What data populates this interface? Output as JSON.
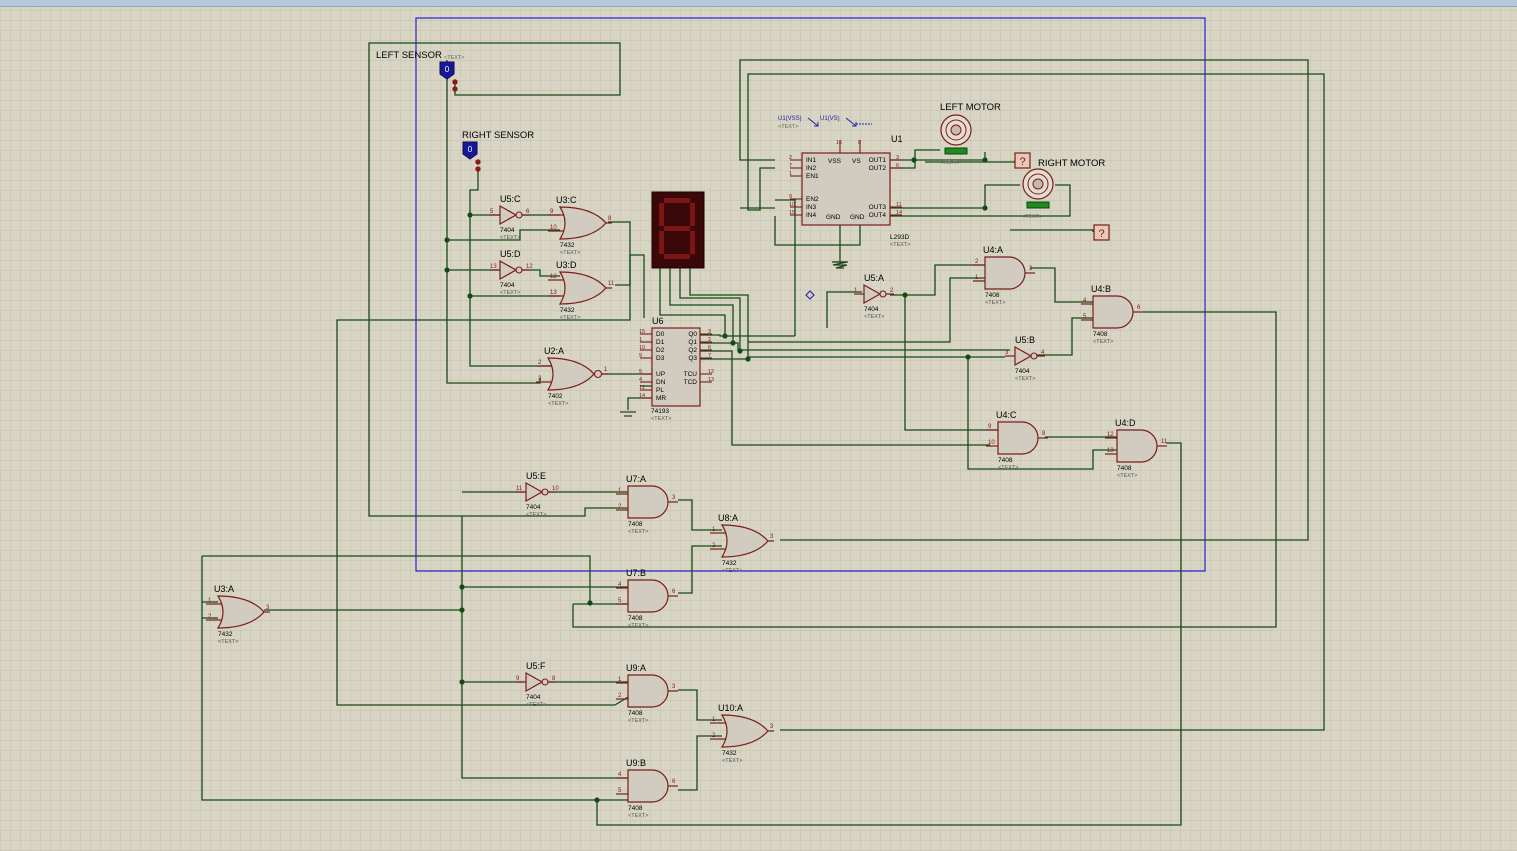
{
  "colors": {
    "background": "#d8d5c4",
    "grid": "#c4c1ae",
    "wire": "#154a15",
    "component_body": "#d2ccc0",
    "component_outline": "#7a1c1c",
    "label": "#000000",
    "sub_label": "#555555",
    "sheet_border": "#2525d0",
    "seven_segment_bg": "#3a0808",
    "seven_segment_on": "#7c1515",
    "probe": "#18189a",
    "motor_indicator": "#1f8a1f"
  },
  "sensors": [
    {
      "id": "left",
      "label": "LEFT SENSOR",
      "value": "0",
      "text": "<TEXT>"
    },
    {
      "id": "right",
      "label": "RIGHT SENSOR",
      "value": "0"
    }
  ],
  "motors": [
    {
      "id": "left",
      "label": "LEFT MOTOR",
      "text": "<TEXT>",
      "unknown": "?"
    },
    {
      "id": "right",
      "label": "RIGHT MOTOR",
      "text": "<TEXT>",
      "unknown": "?"
    }
  ],
  "driver": {
    "name": "U1",
    "part": "L293D",
    "text": "<TEXT>",
    "power_labels": [
      "U1(VSS)",
      "U1(VS)"
    ],
    "pins_left": [
      {
        "name": "IN1",
        "num": "2"
      },
      {
        "name": "IN2",
        "num": "7"
      },
      {
        "name": "EN1",
        "num": "1"
      },
      {
        "name": "EN2",
        "num": "9"
      },
      {
        "name": "IN3",
        "num": "10"
      },
      {
        "name": "IN4",
        "num": "15"
      }
    ],
    "pins_right": [
      {
        "name": "OUT1",
        "num": "3"
      },
      {
        "name": "OUT2",
        "num": "6"
      },
      {
        "name": "OUT3",
        "num": "11"
      },
      {
        "name": "OUT4",
        "num": "14"
      }
    ],
    "top": [
      "VSS",
      "VS"
    ],
    "top_nums": [
      "16",
      "8"
    ],
    "bottom": [
      "GND",
      "GND"
    ]
  },
  "counter": {
    "name": "U6",
    "part": "74193",
    "text": "<TEXT>",
    "pins_left": [
      {
        "name": "D0",
        "num": "15"
      },
      {
        "name": "D1",
        "num": "1"
      },
      {
        "name": "D2",
        "num": "10"
      },
      {
        "name": "D3",
        "num": "9"
      },
      {
        "name": "UP",
        "num": "5"
      },
      {
        "name": "DN",
        "num": "4"
      },
      {
        "name": "PL",
        "num": "11"
      },
      {
        "name": "MR",
        "num": "14"
      }
    ],
    "pins_right": [
      {
        "name": "Q0",
        "num": "3"
      },
      {
        "name": "Q1",
        "num": "2"
      },
      {
        "name": "Q2",
        "num": "6"
      },
      {
        "name": "Q3",
        "num": "7"
      },
      {
        "name": "TCU",
        "num": "12"
      },
      {
        "name": "TCD",
        "num": "13"
      }
    ]
  },
  "gates": [
    {
      "name": "U5:C",
      "part": "7404",
      "type": "not",
      "pins": [
        "5",
        "6"
      ],
      "text": "<TEXT>"
    },
    {
      "name": "U5:D",
      "part": "7404",
      "type": "not",
      "pins": [
        "13",
        "12"
      ],
      "text": "<TEXT>"
    },
    {
      "name": "U3:C",
      "part": "7432",
      "type": "or",
      "pins": [
        "9",
        "10",
        "8"
      ],
      "text": "<TEXT>"
    },
    {
      "name": "U3:D",
      "part": "7432",
      "type": "or",
      "pins": [
        "12",
        "13",
        "11"
      ],
      "text": "<TEXT>"
    },
    {
      "name": "U2:A",
      "part": "7402",
      "type": "nor",
      "pins": [
        "2",
        "3",
        "1"
      ],
      "text": "<TEXT>"
    },
    {
      "name": "U5:A",
      "part": "7404",
      "type": "not",
      "pins": [
        "1",
        "2"
      ],
      "text": "<TEXT>"
    },
    {
      "name": "U4:A",
      "part": "7408",
      "type": "and",
      "pins": [
        "2",
        "1",
        "3"
      ],
      "text": "<TEXT>"
    },
    {
      "name": "U4:B",
      "part": "7408",
      "type": "and",
      "pins": [
        "4",
        "5",
        "6"
      ],
      "text": "<TEXT>"
    },
    {
      "name": "U5:B",
      "part": "7404",
      "type": "not",
      "pins": [
        "3",
        "4"
      ],
      "text": "<TEXT>"
    },
    {
      "name": "U4:C",
      "part": "7408",
      "type": "and",
      "pins": [
        "9",
        "10",
        "8"
      ],
      "text": "<TEXT>"
    },
    {
      "name": "U4:D",
      "part": "7408",
      "type": "and",
      "pins": [
        "12",
        "13",
        "11"
      ],
      "text": "<TEXT>"
    },
    {
      "name": "U5:E",
      "part": "7404",
      "type": "not",
      "pins": [
        "11",
        "10"
      ],
      "text": "<TEXT>"
    },
    {
      "name": "U7:A",
      "part": "7408",
      "type": "and",
      "pins": [
        "1",
        "2",
        "3"
      ],
      "text": "<TEXT>"
    },
    {
      "name": "U8:A",
      "part": "7432",
      "type": "or",
      "pins": [
        "1",
        "2",
        "3"
      ],
      "text": "<TEXT>"
    },
    {
      "name": "U7:B",
      "part": "7408",
      "type": "and",
      "pins": [
        "4",
        "5",
        "6"
      ],
      "text": "<TEXT>"
    },
    {
      "name": "U3:A",
      "part": "7432",
      "type": "or",
      "pins": [
        "1",
        "2",
        "3"
      ],
      "text": "<TEXT>"
    },
    {
      "name": "U5:F",
      "part": "7404",
      "type": "not",
      "pins": [
        "9",
        "8"
      ],
      "text": "<TEXT>"
    },
    {
      "name": "U9:A",
      "part": "7408",
      "type": "and",
      "pins": [
        "1",
        "2",
        "3"
      ],
      "text": "<TEXT>"
    },
    {
      "name": "U10:A",
      "part": "7432",
      "type": "or",
      "pins": [
        "1",
        "2",
        "3"
      ],
      "text": "<TEXT>"
    },
    {
      "name": "U9:B",
      "part": "7408",
      "type": "and",
      "pins": [
        "4",
        "5",
        "6"
      ],
      "text": "<TEXT>"
    }
  ],
  "display": {
    "digit": "8"
  }
}
